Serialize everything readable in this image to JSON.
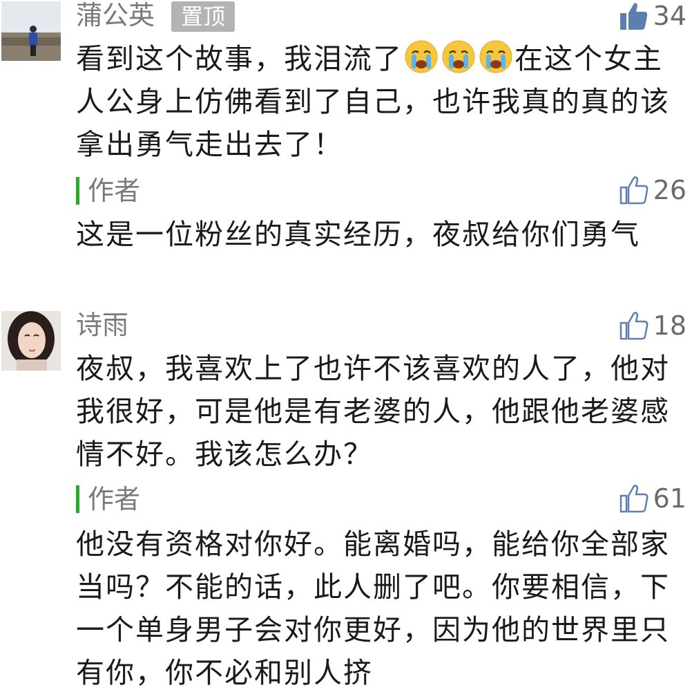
{
  "comments": [
    {
      "username": "蒲公英",
      "badge": "置顶",
      "likes": "34",
      "text_before_emoji": "看到这个故事，我泪流了",
      "emoji_icon": "crying-face-icon",
      "text_after_emoji": "在这个女主人公身上仿佛看到了自己，也许我真的真的该拿出勇气走出去了！",
      "reply": {
        "author": "作者",
        "likes": "26",
        "text": "这是一位粉丝的真实经历，夜叔给你们勇气"
      }
    },
    {
      "username": "诗雨",
      "likes": "18",
      "text": "夜叔，我喜欢上了也许不该喜欢的人了，他对我很好，可是他是有老婆的人，他跟他老婆感情不好。我该怎么办？",
      "reply": {
        "author": "作者",
        "likes": "61",
        "text": "他没有资格对你好。能离婚吗，能给你全部家当吗？不能的话，此人删了吧。你要相信，下一个单身男子会对你更好，因为他的世界里只有你，你不必和别人挤"
      }
    }
  ],
  "colors": {
    "accent_bar": "#2aa829",
    "badge_bg": "#b3b3b3",
    "meta_text": "#7a7a7a",
    "like_filled": "#5a7fb0"
  }
}
